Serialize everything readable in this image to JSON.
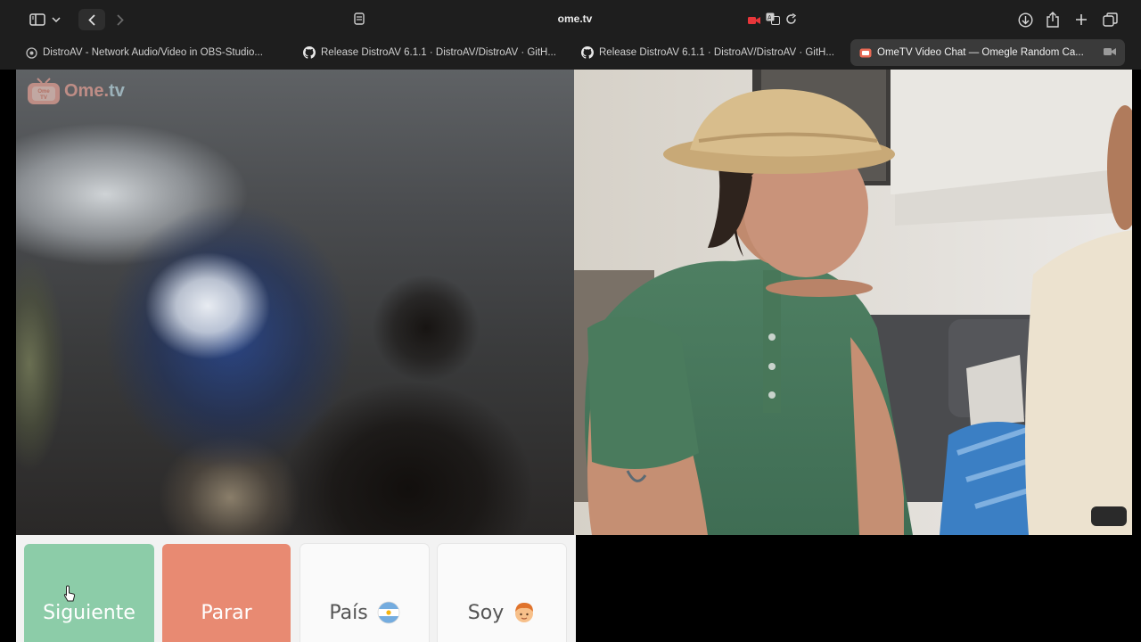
{
  "browser": {
    "address_url": "ome.tv",
    "icons": [
      "sidebar-icon",
      "chevron-down-icon",
      "back-icon",
      "forward-icon",
      "page-settings-icon",
      "camera-in-use-icon",
      "translate-icon",
      "reload-icon",
      "download-icon",
      "share-icon",
      "new-tab-icon",
      "tab-overview-icon"
    ],
    "tabs": [
      {
        "title": "DistroAV - Network Audio/Video in OBS-Studio...",
        "icon": "distroav-favicon",
        "active": false
      },
      {
        "title": "Release DistroAV 6.1.1 · DistroAV/DistroAV · GitH...",
        "icon": "github-icon",
        "active": false
      },
      {
        "title": "Release DistroAV 6.1.1 · DistroAV/DistroAV · GitH...",
        "icon": "github-icon",
        "active": false
      },
      {
        "title": "OmeTV Video Chat — Omegle Random Ca...",
        "icon": "ometv-favicon",
        "active": true
      }
    ]
  },
  "site": {
    "logo_small_text": "Ome TV",
    "logo_text_ome": "Ome.",
    "logo_text_tv": "tv"
  },
  "controls": {
    "next_label": "Siguiente",
    "stop_label": "Parar",
    "country_label": "País",
    "country_flag": "argentina-flag-icon",
    "gender_label": "Soy",
    "gender_icon": "boy-face-icon",
    "colors": {
      "next": "#8ccca8",
      "stop": "#e88a72",
      "neutral": "#fafafa"
    }
  }
}
